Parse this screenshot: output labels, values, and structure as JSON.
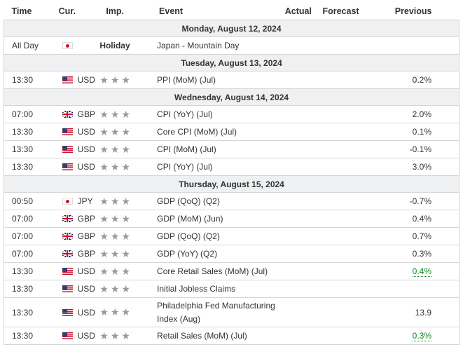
{
  "header": {
    "time": "Time",
    "currency": "Cur.",
    "importance": "Imp.",
    "event": "Event",
    "actual": "Actual",
    "forecast": "Forecast",
    "previous": "Previous"
  },
  "colors": {
    "positive": "#0c8a1c",
    "star": "#999999",
    "day_bg": "#eff0f2"
  },
  "stars": "★★★",
  "days": [
    {
      "label": "Monday, August 12, 2024"
    },
    {
      "label": "Tuesday, August 13, 2024"
    },
    {
      "label": "Wednesday, August 14, 2024"
    },
    {
      "label": "Thursday, August 15, 2024"
    }
  ],
  "rows": [
    {
      "time": "All Day",
      "flag": "jp",
      "currency": "",
      "importance": "Holiday",
      "event": "Japan - Mountain Day",
      "actual": "",
      "forecast": "",
      "previous": ""
    },
    {
      "time": "13:30",
      "flag": "us",
      "currency": "USD",
      "event": "PPI (MoM) (Jul)",
      "actual": "",
      "forecast": "",
      "previous": "0.2%"
    },
    {
      "time": "07:00",
      "flag": "gb",
      "currency": "GBP",
      "event": "CPI (YoY) (Jul)",
      "actual": "",
      "forecast": "",
      "previous": "2.0%"
    },
    {
      "time": "13:30",
      "flag": "us",
      "currency": "USD",
      "event": "Core CPI (MoM) (Jul)",
      "actual": "",
      "forecast": "",
      "previous": "0.1%"
    },
    {
      "time": "13:30",
      "flag": "us",
      "currency": "USD",
      "event": "CPI (MoM) (Jul)",
      "actual": "",
      "forecast": "",
      "previous": "-0.1%"
    },
    {
      "time": "13:30",
      "flag": "us",
      "currency": "USD",
      "event": "CPI (YoY) (Jul)",
      "actual": "",
      "forecast": "",
      "previous": "3.0%"
    },
    {
      "time": "00:50",
      "flag": "jp",
      "currency": "JPY",
      "event": "GDP (QoQ) (Q2)",
      "actual": "",
      "forecast": "",
      "previous": "-0.7%"
    },
    {
      "time": "07:00",
      "flag": "gb",
      "currency": "GBP",
      "event": "GDP (MoM) (Jun)",
      "actual": "",
      "forecast": "",
      "previous": "0.4%"
    },
    {
      "time": "07:00",
      "flag": "gb",
      "currency": "GBP",
      "event": "GDP (QoQ) (Q2)",
      "actual": "",
      "forecast": "",
      "previous": "0.7%"
    },
    {
      "time": "07:00",
      "flag": "gb",
      "currency": "GBP",
      "event": "GDP (YoY) (Q2)",
      "actual": "",
      "forecast": "",
      "previous": "0.3%"
    },
    {
      "time": "13:30",
      "flag": "us",
      "currency": "USD",
      "event": "Core Retail Sales (MoM) (Jul)",
      "actual": "",
      "forecast": "",
      "previous": "0.4%",
      "previous_revised": true
    },
    {
      "time": "13:30",
      "flag": "us",
      "currency": "USD",
      "event": "Initial Jobless Claims",
      "actual": "",
      "forecast": "",
      "previous": ""
    },
    {
      "time": "13:30",
      "flag": "us",
      "currency": "USD",
      "event": "Philadelphia Fed Manufacturing Index (Aug)",
      "actual": "",
      "forecast": "",
      "previous": "13.9"
    },
    {
      "time": "13:30",
      "flag": "us",
      "currency": "USD",
      "event": "Retail Sales (MoM) (Jul)",
      "actual": "",
      "forecast": "",
      "previous": "0.3%",
      "previous_revised": true
    }
  ]
}
